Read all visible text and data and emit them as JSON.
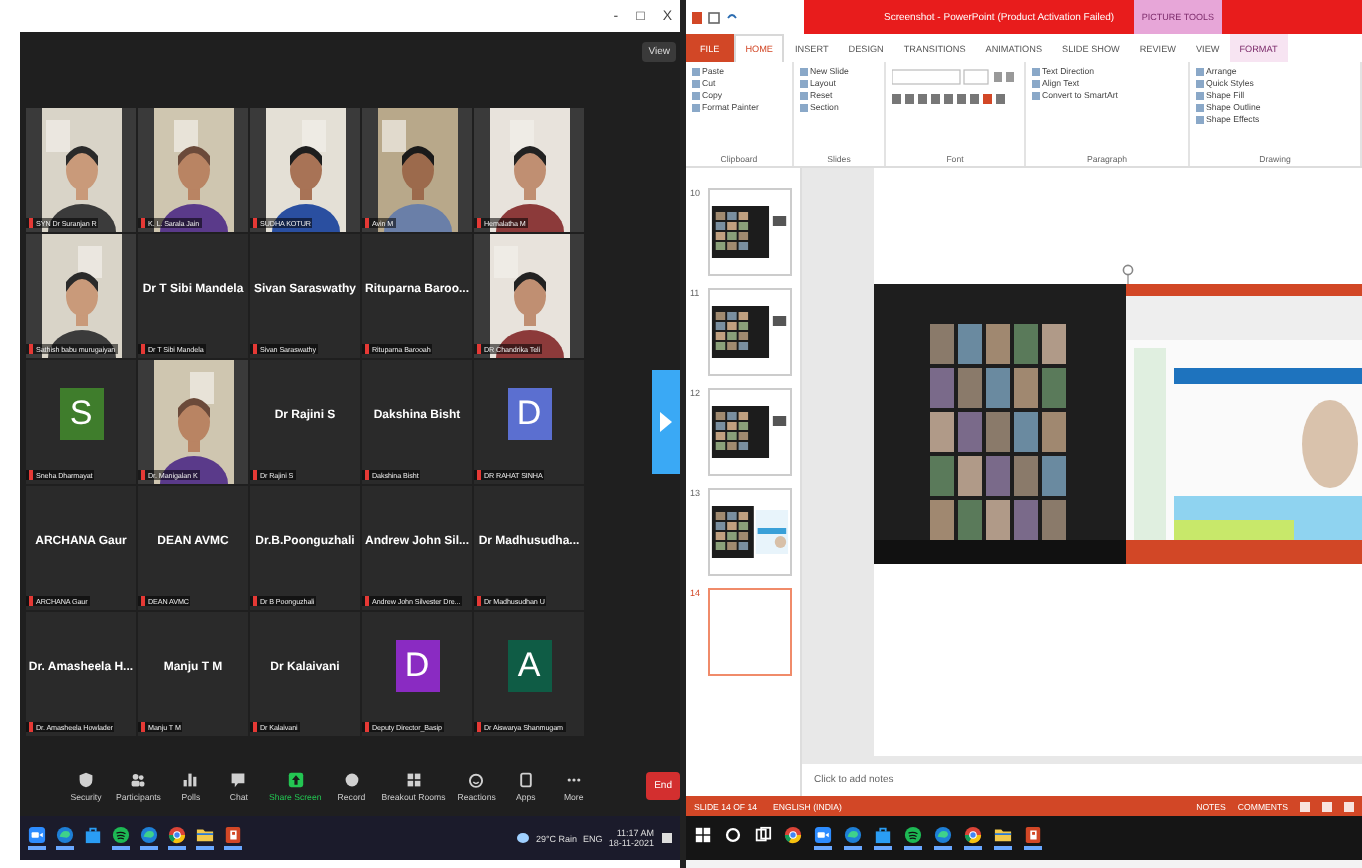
{
  "zoom": {
    "window_controls": [
      "-",
      "□",
      "X"
    ],
    "view_button": "View",
    "tiles": [
      {
        "kind": "video",
        "display_name": "SYN Dr Suranjan R"
      },
      {
        "kind": "video",
        "display_name": "K. L. Sarala Jain"
      },
      {
        "kind": "video",
        "display_name": "SUDHA KOTUR"
      },
      {
        "kind": "video",
        "display_name": "Avin M"
      },
      {
        "kind": "video",
        "display_name": "Hemalatha M"
      },
      {
        "kind": "video",
        "display_name": "Sathish babu murugaiyan"
      },
      {
        "kind": "name",
        "title": "Dr T Sibi Mandela",
        "display_name": "Dr T Sibi Mandela"
      },
      {
        "kind": "name",
        "title": "Sivan Saraswathy",
        "display_name": "Sivan Saraswathy"
      },
      {
        "kind": "name",
        "title": "Rituparna Baroo...",
        "display_name": "Rituparna Barooah"
      },
      {
        "kind": "video",
        "display_name": "DR Chandrika Teli"
      },
      {
        "kind": "avatar",
        "letter": "S",
        "color": "#3f7d2c",
        "display_name": "Sneha Dharmayat"
      },
      {
        "kind": "video",
        "display_name": "Dr. Manigalan K"
      },
      {
        "kind": "name",
        "title": "Dr Rajini S",
        "display_name": "Dr Rajini S"
      },
      {
        "kind": "name",
        "title": "Dakshina Bisht",
        "display_name": "Dakshina Bisht"
      },
      {
        "kind": "avatar",
        "letter": "D",
        "color": "#5b6fd0",
        "display_name": "DR RAHAT SINHA"
      },
      {
        "kind": "name",
        "title": "ARCHANA Gaur",
        "display_name": "ARCHANA Gaur"
      },
      {
        "kind": "name",
        "title": "DEAN AVMC",
        "display_name": "DEAN AVMC"
      },
      {
        "kind": "name",
        "title": "Dr.B.Poonguzhali",
        "display_name": "Dr B Poonguzhali"
      },
      {
        "kind": "name",
        "title": "Andrew John Sil...",
        "display_name": "Andrew John Silvester Dre..."
      },
      {
        "kind": "name",
        "title": "Dr Madhusudha...",
        "display_name": "Dr Madhusudhan U"
      },
      {
        "kind": "name",
        "title": "Dr. Amasheela H...",
        "display_name": "Dr. Amasheela Howlader"
      },
      {
        "kind": "name",
        "title": "Manju T M",
        "display_name": "Manju T M"
      },
      {
        "kind": "name",
        "title": "Dr Kalaivani",
        "display_name": "Dr Kalaivani"
      },
      {
        "kind": "avatar",
        "letter": "D",
        "color": "#8a2bc2",
        "display_name": "Deputy Director_Basip"
      },
      {
        "kind": "avatar",
        "letter": "A",
        "color": "#0f5c45",
        "display_name": "Dr Aiswarya Shanmugam"
      }
    ],
    "toolbar": [
      {
        "kind": "security",
        "label": "Security",
        "active": false
      },
      {
        "kind": "participants",
        "label": "Participants",
        "active": false
      },
      {
        "kind": "polls",
        "label": "Polls",
        "active": false
      },
      {
        "kind": "chat",
        "label": "Chat",
        "active": false
      },
      {
        "kind": "share",
        "label": "Share Screen",
        "active": true
      },
      {
        "kind": "record",
        "label": "Record",
        "active": false
      },
      {
        "kind": "breakout",
        "label": "Breakout Rooms",
        "active": false
      },
      {
        "kind": "reactions",
        "label": "Reactions",
        "active": false
      },
      {
        "kind": "apps",
        "label": "Apps",
        "active": false
      },
      {
        "kind": "more",
        "label": "More",
        "active": false
      }
    ],
    "end_button": "End"
  },
  "taskbar_left": {
    "apps": [
      {
        "kind": "zoom",
        "active": true
      },
      {
        "kind": "edge",
        "active": true
      },
      {
        "kind": "mail",
        "active": false
      },
      {
        "kind": "spotify",
        "active": true
      },
      {
        "kind": "edge",
        "active": true
      },
      {
        "kind": "chrome",
        "active": true
      },
      {
        "kind": "files",
        "active": true
      },
      {
        "kind": "powerpoint",
        "active": true
      }
    ],
    "weather": "29°C Rain",
    "language": "ENG",
    "time": "11:17 AM",
    "date": "18-11-2021"
  },
  "powerpoint": {
    "title": "Screenshot - PowerPoint (Product Activation Failed)",
    "contextual_title": "PICTURE TOOLS",
    "tabs": [
      {
        "label": "FILE",
        "kind": "file",
        "selected": false
      },
      {
        "label": "HOME",
        "kind": "normal",
        "selected": true
      },
      {
        "label": "INSERT",
        "kind": "normal",
        "selected": false
      },
      {
        "label": "DESIGN",
        "kind": "normal",
        "selected": false
      },
      {
        "label": "TRANSITIONS",
        "kind": "normal",
        "selected": false
      },
      {
        "label": "ANIMATIONS",
        "kind": "normal",
        "selected": false
      },
      {
        "label": "SLIDE SHOW",
        "kind": "normal",
        "selected": false
      },
      {
        "label": "REVIEW",
        "kind": "normal",
        "selected": false
      },
      {
        "label": "VIEW",
        "kind": "normal",
        "selected": false
      },
      {
        "label": "FORMAT",
        "kind": "contextual",
        "selected": false
      }
    ],
    "ribbon": [
      {
        "kind": "clipboard",
        "label": "Clipboard",
        "commands": [
          "Paste",
          "Cut",
          "Copy",
          "Format Painter"
        ]
      },
      {
        "kind": "slides",
        "label": "Slides",
        "commands": [
          "New Slide",
          "Layout",
          "Reset",
          "Section"
        ]
      },
      {
        "kind": "font",
        "label": "Font"
      },
      {
        "kind": "paragraph",
        "label": "Paragraph",
        "commands": [
          "Text Direction",
          "Align Text",
          "Convert to SmartArt"
        ]
      },
      {
        "kind": "drawing",
        "label": "Drawing",
        "commands": [
          "Arrange",
          "Quick Styles",
          "Shape Fill",
          "Shape Outline",
          "Shape Effects"
        ]
      }
    ],
    "thumbnails": [
      {
        "number": "10",
        "kind": "screenshot",
        "selected": false
      },
      {
        "number": "11",
        "kind": "screenshot",
        "selected": false
      },
      {
        "number": "12",
        "kind": "screenshot",
        "selected": false
      },
      {
        "number": "13",
        "kind": "dual",
        "selected": false
      },
      {
        "number": "14",
        "kind": "blank",
        "selected": true
      }
    ],
    "notes_placeholder": "Click to add notes",
    "status": {
      "slide": "SLIDE 14 OF 14",
      "language": "ENGLISH (INDIA)",
      "notes": "NOTES",
      "comments": "COMMENTS"
    }
  },
  "taskbar_right": {
    "apps": [
      {
        "kind": "start",
        "active": false
      },
      {
        "kind": "search",
        "active": false
      },
      {
        "kind": "taskview",
        "active": false
      },
      {
        "kind": "chrome",
        "active": false
      },
      {
        "kind": "zoom",
        "active": true
      },
      {
        "kind": "edge",
        "active": true
      },
      {
        "kind": "mail",
        "active": true
      },
      {
        "kind": "spotify",
        "active": true
      },
      {
        "kind": "edge",
        "active": true
      },
      {
        "kind": "chrome",
        "active": true
      },
      {
        "kind": "files",
        "active": true
      },
      {
        "kind": "powerpoint",
        "active": true
      }
    ]
  }
}
